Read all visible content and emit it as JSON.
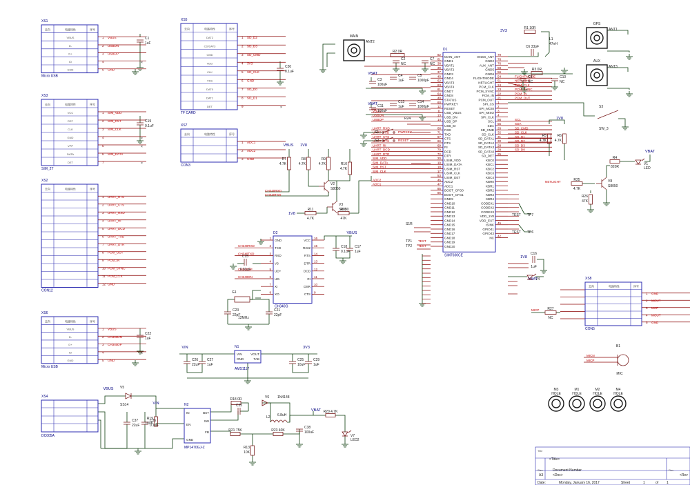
{
  "connector_headers": [
    "去向",
    "电路特性",
    "序号"
  ],
  "xs1": {
    "ref": "XS1",
    "title": "Micro USB",
    "rows": [
      {
        "n": "1",
        "signal": "VBUS",
        "inner": "VBUS"
      },
      {
        "n": "2",
        "signal": "USBDN",
        "inner": "D-"
      },
      {
        "n": "3",
        "signal": "USBDP",
        "inner": "D+"
      },
      {
        "n": "4",
        "signal": "",
        "inner": "ID"
      },
      {
        "n": "5",
        "signal": "GND",
        "inner": "GND"
      }
    ],
    "cap_ref": "C1",
    "cap_val": "1uF"
  },
  "xs3": {
    "ref": "XS3",
    "title": "SIM_2T",
    "rows": [
      {
        "n": "1",
        "signal": "SIM_VDD",
        "inner": "VCC"
      },
      {
        "n": "2",
        "signal": "SIM_RST",
        "inner": "RST"
      },
      {
        "n": "3",
        "signal": "SIM_CLK",
        "inner": "CLK"
      },
      {
        "n": "4",
        "signal": "",
        "inner": "GND"
      },
      {
        "n": "5",
        "signal": "",
        "inner": "VPP"
      },
      {
        "n": "6",
        "signal": "SIM_DATA",
        "inner": "DATA"
      },
      {
        "n": "7",
        "signal": "",
        "inner": "DET"
      }
    ],
    "cap_ref": "C19",
    "cap_val": "0.1uF"
  },
  "xs2": {
    "ref": "XS2",
    "title": "CON12",
    "rows": [
      {
        "n": "1",
        "signal": "UART_RTS"
      },
      {
        "n": "2",
        "signal": "UART_CTS"
      },
      {
        "n": "3",
        "signal": "UART_RXD"
      },
      {
        "n": "4",
        "signal": "UART_RI"
      },
      {
        "n": "5",
        "signal": "UART_DCD"
      },
      {
        "n": "6",
        "signal": "UART_TXD"
      },
      {
        "n": "7",
        "signal": "UART_DTR"
      },
      {
        "n": "8",
        "signal": "PCM_OUT"
      },
      {
        "n": "9",
        "signal": "PCM_IN"
      },
      {
        "n": "10",
        "signal": "PCM_SYNC"
      },
      {
        "n": "11",
        "signal": "PCM_CLK"
      },
      {
        "n": "12",
        "signal": "GND"
      }
    ]
  },
  "xs6": {
    "ref": "XS6",
    "title": "Micro USB",
    "rows": [
      {
        "n": "1",
        "signal": "VBUS",
        "inner": "VBUS"
      },
      {
        "n": "2",
        "signal": "CH340DN",
        "inner": "D-"
      },
      {
        "n": "3",
        "signal": "CH340DP",
        "inner": "D+"
      },
      {
        "n": "4",
        "signal": "",
        "inner": "ID"
      },
      {
        "n": "5",
        "signal": "GND",
        "inner": "GND"
      }
    ],
    "cap_ref": "C22",
    "cap_val": "1uF"
  },
  "xs4": {
    "ref": "XS4",
    "title": "DC005A"
  },
  "xs5": {
    "ref": "XS5",
    "title": "TF CARD",
    "rows": [
      {
        "n": "1",
        "signal": "SD_D2",
        "inner": "DAT2"
      },
      {
        "n": "2",
        "signal": "SD_D3",
        "inner": "CD/DAT3"
      },
      {
        "n": "3",
        "signal": "SD_CMD",
        "inner": "CMD"
      },
      {
        "n": "4",
        "signal": "3V3",
        "inner": "VDD"
      },
      {
        "n": "5",
        "signal": "SD_CLK",
        "inner": "CLK"
      },
      {
        "n": "6",
        "signal": "GND",
        "inner": "VSS"
      },
      {
        "n": "7",
        "signal": "SD_D0",
        "inner": "DAT0"
      },
      {
        "n": "8",
        "signal": "SD_D1",
        "inner": "DAT1"
      },
      {
        "n": "9",
        "signal": "",
        "inner": "DET"
      }
    ],
    "cap_ref": "C30",
    "cap_val": "0.1uF"
  },
  "xs7": {
    "ref": "XS7",
    "title": "CON3",
    "rows": [
      {
        "n": "1",
        "signal": "ADC1"
      },
      {
        "n": "2",
        "signal": "ADC2"
      },
      {
        "n": "3",
        "signal": "GND"
      }
    ]
  },
  "xs8": {
    "ref": "XS8",
    "title": "CON5",
    "rows": [
      {
        "n": "1",
        "signal": "GND"
      },
      {
        "n": "2",
        "signal": "MOUT"
      },
      {
        "n": "3",
        "signal": "MCP"
      },
      {
        "n": "4",
        "signal": "MOUT"
      },
      {
        "n": "5",
        "signal": "GND"
      }
    ]
  },
  "u1": {
    "ref": "D1",
    "name": "SIM7600CE",
    "left": [
      {
        "n": "82",
        "label": "MAIN_ANT"
      },
      {
        "n": "81",
        "label": "GND1"
      },
      {
        "n": "38",
        "label": "VBAT1"
      },
      {
        "n": "39",
        "label": "VBAT2"
      },
      {
        "n": "37",
        "label": "GND3"
      },
      {
        "n": "40",
        "label": "GND4"
      },
      {
        "n": "62",
        "label": "VBAT3"
      },
      {
        "n": "63",
        "label": "VBAT4"
      },
      {
        "n": "61",
        "label": "GND7"
      },
      {
        "n": "64",
        "label": "GND8"
      },
      {
        "n": "49",
        "label": "STATUS"
      },
      {
        "n": "60",
        "label": "PWRKEY"
      },
      {
        "n": "12",
        "label": "RESET"
      },
      {
        "n": "11",
        "label": "USB_VBUS"
      },
      {
        "n": "13",
        "label": "USB_DN"
      },
      {
        "n": "14",
        "label": "USB_DP"
      },
      {
        "n": "",
        "label": "USB_ID"
      },
      {
        "n": "68",
        "label": "RXD"
      },
      {
        "n": "71",
        "label": "TXD"
      },
      {
        "n": "67",
        "label": "CTS"
      },
      {
        "n": "66",
        "label": "RTS"
      },
      {
        "n": "69",
        "label": "RI"
      },
      {
        "n": "70",
        "label": "DCD"
      },
      {
        "n": "72",
        "label": "DTR"
      },
      {
        "n": "20",
        "label": "USIM_VDD"
      },
      {
        "n": "19",
        "label": "USIM_DATA"
      },
      {
        "n": "18",
        "label": "USIM_RST"
      },
      {
        "n": "17",
        "label": "USIM_CLK"
      },
      {
        "n": "53",
        "label": "USIM_DET"
      },
      {
        "n": "46",
        "label": "ADC2"
      },
      {
        "n": "47",
        "label": "ADC1"
      },
      {
        "n": "85",
        "label": "BOOT_CFG0"
      },
      {
        "n": "86",
        "label": "BOOT_CFG1"
      },
      {
        "n": "",
        "label": "GND9"
      },
      {
        "n": "",
        "label": "GND10"
      },
      {
        "n": "",
        "label": "GND11"
      },
      {
        "n": "",
        "label": "GND12"
      },
      {
        "n": "",
        "label": "GND13"
      },
      {
        "n": "",
        "label": "GND14"
      },
      {
        "n": "",
        "label": "GND15"
      },
      {
        "n": "",
        "label": "GND16"
      },
      {
        "n": "",
        "label": "GND17"
      },
      {
        "n": "",
        "label": "GND18"
      },
      {
        "n": "",
        "label": "GND19"
      },
      {
        "n": "",
        "label": "GND20"
      }
    ],
    "right": [
      {
        "n": "79",
        "label": "GNSS_ANT"
      },
      {
        "n": "78",
        "label": "GND2"
      },
      {
        "n": "76",
        "label": "AUX_ANT"
      },
      {
        "n": "58",
        "label": "GND5"
      },
      {
        "n": "56",
        "label": "GND6"
      },
      {
        "n": "54",
        "label": "FLIGHTMODE"
      },
      {
        "n": "51",
        "label": "NETLIGHT"
      },
      {
        "n": "24",
        "label": "PCM_CLK"
      },
      {
        "n": "23",
        "label": "PCM_SYNC"
      },
      {
        "n": "22",
        "label": "PCM_IN"
      },
      {
        "n": "21",
        "label": "PCM_OUT"
      },
      {
        "n": "1",
        "label": "SPI_CS"
      },
      {
        "n": "2",
        "label": "SPI_MOSI"
      },
      {
        "n": "3",
        "label": "SPI_MISO"
      },
      {
        "n": "4",
        "label": "SPI_CLK"
      },
      {
        "n": "56",
        "label": "SCL"
      },
      {
        "n": "55",
        "label": "SDA"
      },
      {
        "n": "26",
        "label": "SD_CMD"
      },
      {
        "n": "32",
        "label": "SD_CLK"
      },
      {
        "n": "31",
        "label": "SD_DATA1"
      },
      {
        "n": "30",
        "label": "SD_DATA2"
      },
      {
        "n": "28",
        "label": "SD_DATA3"
      },
      {
        "n": "29",
        "label": "SD_DATA0"
      },
      {
        "n": "25",
        "label": "SD_DET"
      },
      {
        "n": "",
        "label": "KBC0"
      },
      {
        "n": "",
        "label": "KBC1"
      },
      {
        "n": "",
        "label": "KBC2"
      },
      {
        "n": "",
        "label": "KBC3"
      },
      {
        "n": "",
        "label": "KBC4"
      },
      {
        "n": "",
        "label": "KBR0"
      },
      {
        "n": "",
        "label": "KBR1"
      },
      {
        "n": "",
        "label": "KBR2"
      },
      {
        "n": "",
        "label": "KBR3"
      },
      {
        "n": "",
        "label": "KBR4"
      },
      {
        "n": "",
        "label": "CODEX1"
      },
      {
        "n": "",
        "label": "CODEX2"
      },
      {
        "n": "",
        "label": "CODEX3"
      },
      {
        "n": "",
        "label": "VDD_1V8"
      },
      {
        "n": "",
        "label": "VDD_EXT"
      },
      {
        "n": "45",
        "label": "ISINK"
      },
      {
        "n": "",
        "label": "GPIO41"
      },
      {
        "n": "",
        "label": "GPIO43"
      },
      {
        "n": "42",
        "label": "NC"
      }
    ],
    "right_nets": [
      {
        "label": "FLIGHTMODE",
        "pin": "FLIGHTMODE"
      },
      {
        "label": "NETLIGHT",
        "pin": "NETLIGHT"
      },
      {
        "label": "PCM_CLK",
        "pin": "PCM_CLK"
      },
      {
        "label": "PCM_SYNC",
        "pin": "PCM_SYNC"
      },
      {
        "label": "PCM_IN",
        "pin": "PCM_IN"
      },
      {
        "label": "PCM_OUT",
        "pin": "PCM_OUT"
      },
      {
        "label": "SCL",
        "pin": "SCL"
      },
      {
        "label": "SDA",
        "pin": "SDA"
      },
      {
        "label": "SD_CMD",
        "pin": "SD_CMD"
      },
      {
        "label": "SD_CLK",
        "pin": "SD_CLK"
      },
      {
        "label": "SD_D1",
        "pin": "SD_DATA1"
      },
      {
        "label": "SD_D2",
        "pin": "SD_DATA2"
      },
      {
        "label": "SD_D3",
        "pin": "SD_DATA3"
      },
      {
        "label": "SD_D0",
        "pin": "SD_DATA0"
      }
    ],
    "left_nets": [
      {
        "label": "VBUS",
        "pin": "USB_VBUS"
      },
      {
        "label": "USBDN",
        "pin": "USB_DN"
      },
      {
        "label": "USBDP",
        "pin": "USB_DP"
      },
      {
        "label": "UART_RXD",
        "pin": "RXD"
      },
      {
        "label": "UART_TXD",
        "pin": "TXD"
      },
      {
        "label": "UART_CTS",
        "pin": "CTS"
      },
      {
        "label": "UART_RTS",
        "pin": "RTS"
      },
      {
        "label": "UART_RI",
        "pin": "RI"
      },
      {
        "label": "UART_DCD",
        "pin": "DCD"
      },
      {
        "label": "UART_DTR",
        "pin": "DTR"
      },
      {
        "label": "SIM_VDD",
        "pin": "USIM_VDD"
      },
      {
        "label": "SIM_DATA",
        "pin": "USIM_DATA"
      },
      {
        "label": "SIM_RST",
        "pin": "USIM_RST"
      },
      {
        "label": "SIM_CLK",
        "pin": "USIM_CLK"
      },
      {
        "label": "ADC2",
        "pin": "ADC2"
      },
      {
        "label": "ADC1",
        "pin": "ADC1"
      }
    ]
  },
  "u2": {
    "ref": "D2",
    "name": "CH340G",
    "left": [
      {
        "n": "1",
        "label": "GND"
      },
      {
        "n": "2",
        "label": "TXD"
      },
      {
        "n": "3",
        "label": "RXD"
      },
      {
        "n": "4",
        "label": "V3"
      },
      {
        "n": "5",
        "label": "UD+"
      },
      {
        "n": "6",
        "label": "UD-"
      },
      {
        "n": "7",
        "label": "XI"
      },
      {
        "n": "8",
        "label": "XO"
      }
    ],
    "right": [
      {
        "n": "16",
        "label": "VCC"
      },
      {
        "n": "15",
        "label": "R232"
      },
      {
        "n": "14",
        "label": "RTS"
      },
      {
        "n": "13",
        "label": "DTR"
      },
      {
        "n": "12",
        "label": "DCD"
      },
      {
        "n": "11",
        "label": "RI"
      },
      {
        "n": "10",
        "label": "DSR"
      },
      {
        "n": "9",
        "label": "CTS"
      }
    ],
    "nets": [
      "CH340RXD",
      "CH340TXD",
      "CH340DP",
      "CH340DN"
    ]
  },
  "parts": {
    "r1": {
      "ref": "R1",
      "val": "10R"
    },
    "r2": {
      "ref": "R2",
      "val": "0R"
    },
    "r3": {
      "ref": "R3",
      "val": "0R"
    },
    "l1": {
      "ref": "L1",
      "val": "47nH"
    },
    "c6": {
      "ref": "C6",
      "val": "33pF"
    },
    "c2": {
      "ref": "C2",
      "val": "NC"
    },
    "c7": {
      "ref": "C7",
      "val": "NC"
    },
    "c9": {
      "ref": "C9",
      "val": "NC"
    },
    "c10": {
      "ref": "C10",
      "val": "NC"
    },
    "c3": {
      "ref": "C3",
      "val": "100uF"
    },
    "c4": {
      "ref": "C4",
      "val": "1uF"
    },
    "c5": {
      "ref": "C5",
      "val": "1000pF"
    },
    "c11": {
      "ref": "C11",
      "val": "100uF"
    },
    "c13": {
      "ref": "C13",
      "val": "1uF"
    },
    "c14": {
      "ref": "C14",
      "val": "1000pF"
    },
    "r24": {
      "ref": "R24",
      "val": ""
    },
    "sw1": {
      "ref": "S1",
      "net": "PWRKEY"
    },
    "sw2": {
      "ref": "S2",
      "net": "RESET"
    },
    "r7": {
      "ref": "R7",
      "val": "4.7K"
    },
    "r8": {
      "ref": "R8",
      "val": "4.7K"
    },
    "r9": {
      "ref": "R9",
      "val": "4.7K"
    },
    "r10": {
      "ref": "R10",
      "val": "4.7K"
    },
    "r11": {
      "ref": "R11",
      "val": "4.7K"
    },
    "r12": {
      "ref": "R12",
      "val": "47K"
    },
    "v2": {
      "ref": "V2",
      "val": "S8050"
    },
    "v3": {
      "ref": "V3",
      "val": "S8050"
    },
    "r5": {
      "ref": "R5",
      "val": "4.7K"
    },
    "r6": {
      "ref": "R6",
      "val": "4.7K"
    },
    "r4": {
      "ref": "R4",
      "val": "820R"
    },
    "v8": {
      "ref": "V8",
      "val": "S8050"
    },
    "r25": {
      "ref": "R25",
      "val": "4.7K"
    },
    "r26": {
      "ref": "R26",
      "val": "47K"
    },
    "v1": {
      "ref": "V1",
      "val": "LED"
    },
    "v4": {
      "ref": "V4",
      "val": "LED"
    },
    "c16": {
      "ref": "C16",
      "val": "1uF"
    },
    "s3": {
      "ref": "S3",
      "val": "SW_3"
    },
    "r27": {
      "ref": "R27",
      "val": "NC"
    },
    "b1": {
      "ref": "B1",
      "val": "MIC"
    },
    "c18": {
      "ref": "C18",
      "val": "0.1uF"
    },
    "c17": {
      "ref": "C17",
      "val": "1uF"
    },
    "c15": {
      "ref": "C15",
      "val": "0.01uF"
    },
    "g1": {
      "ref": "G1",
      "val": "12MHz"
    },
    "c23": {
      "ref": "C23",
      "val": "22pF"
    },
    "c21": {
      "ref": "C21",
      "val": "22pF"
    },
    "n1": {
      "ref": "N1",
      "val": "AMS1117",
      "pins": [
        "VIN",
        "VOUT",
        "GND",
        "TAB"
      ]
    },
    "c26": {
      "ref": "C26",
      "val": "22uF"
    },
    "c27": {
      "ref": "C27",
      "val": "1uF"
    },
    "c25": {
      "ref": "C25",
      "val": "10uF"
    },
    "c29": {
      "ref": "C29",
      "val": "1uF"
    },
    "v5": {
      "ref": "V5",
      "val": "SS14"
    },
    "n2": {
      "ref": "N2",
      "val": "MP1470GJ-Z",
      "pins": [
        "IN",
        "EN",
        "GND",
        "BST",
        "SW",
        "FB"
      ]
    },
    "c37": {
      "ref": "C37",
      "val": "22uF"
    },
    "c36": {
      "ref": "C36",
      "val": "0.1uF"
    },
    "r19": {
      "ref": "R19",
      "val": "100K"
    },
    "r18": {
      "ref": "R18",
      "val": "0R"
    },
    "c35": {
      "ref": "C35",
      "val": ""
    },
    "v6": {
      "ref": "V6",
      "val": "1N4148"
    },
    "l2": {
      "ref": "L2",
      "val": "6.8uH"
    },
    "r21": {
      "ref": "R21",
      "val": "75K"
    },
    "r23": {
      "ref": "R23",
      "val": "40K"
    },
    "r13": {
      "ref": "R13",
      "val": "10K"
    },
    "c38": {
      "ref": "C38",
      "val": "100uF"
    },
    "r20": {
      "ref": "R20",
      "val": "4.7K"
    },
    "v7": {
      "ref": "V7",
      "val": "LED2"
    },
    "main_ant": {
      "ref": "ANT2",
      "val": "MAIN"
    },
    "gps_ant": {
      "ref": "ANT1",
      "val": "GPS"
    },
    "aux_ant": {
      "ref": "ANT3",
      "val": "AUX"
    },
    "tp": [
      {
        "ref": "TP1",
        "net": "TEST"
      },
      {
        "ref": "TP2",
        "net": "TEST"
      }
    ],
    "tp7": {
      "ref": "TP7",
      "net": "TEST"
    },
    "tp6": {
      "ref": "TP6",
      "net": "TEST"
    },
    "s1r": {
      "ref": "S1R"
    }
  },
  "power": {
    "vbus": "VBUS",
    "vbat": "VBAT",
    "v33": "3V3",
    "v18": "1V8",
    "vin": "VIN",
    "v3": "3V3"
  },
  "holes": [
    {
      "ref": "M3",
      "val": "HOLE"
    },
    {
      "ref": "M1",
      "val": "HOLE"
    },
    {
      "ref": "M2",
      "val": "HOLE"
    },
    {
      "ref": "M4",
      "val": "HOLE"
    }
  ],
  "mic_nets": [
    "MICN",
    "MICP"
  ],
  "mic_input_net": "MICP",
  "title_block": {
    "title_label": "Title",
    "title_value": "<Title>",
    "size_label": "Size",
    "size_value": "A3",
    "doc_label": "Document Number",
    "doc_value": "<Doc>",
    "rev_label": "Rev",
    "rev_value": "<Rev",
    "date_label": "Date:",
    "date_value": "Monday, January 16, 2017",
    "sheet_label": "Sheet",
    "sheet_value": "1",
    "of_label": "of",
    "of_value": "1"
  }
}
